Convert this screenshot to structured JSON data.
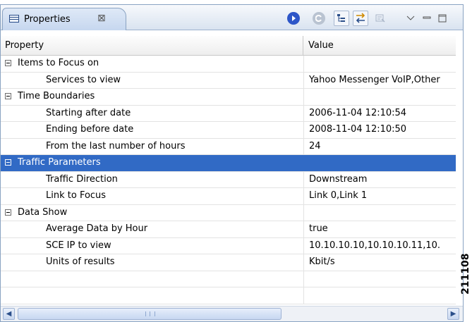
{
  "view": {
    "tab_title": "Properties",
    "tab_close": "⊠",
    "toolbar": {
      "icons": [
        "play-icon",
        "refresh-icon",
        "tree-icon",
        "filter-icon",
        "advanced-icon",
        "view-menu-icon",
        "minimize-icon",
        "maximize-icon"
      ],
      "colors": {
        "play": "#2d56c8",
        "refresh_disabled": "#b9c3d1"
      }
    }
  },
  "table": {
    "headers": {
      "property": "Property",
      "value": "Value"
    },
    "rows": [
      {
        "label": "Items to Focus on",
        "value": "",
        "category": true
      },
      {
        "label": "Services to view",
        "value": "Yahoo Messenger VoIP,Other",
        "category": false
      },
      {
        "label": "Time Boundaries",
        "value": "",
        "category": true
      },
      {
        "label": "Starting after date",
        "value": "2006-11-04 12:10:54",
        "category": false
      },
      {
        "label": "Ending before date",
        "value": "2008-11-04 12:10:50",
        "category": false
      },
      {
        "label": "From the last number of hours",
        "value": "24",
        "category": false
      },
      {
        "label": "Traffic Parameters",
        "value": "",
        "category": true,
        "selected": true
      },
      {
        "label": "Traffic Direction",
        "value": "Downstream",
        "category": false
      },
      {
        "label": "Link to Focus",
        "value": "Link 0,Link 1",
        "category": false
      },
      {
        "label": "Data Show",
        "value": "",
        "category": true
      },
      {
        "label": "Average Data by Hour",
        "value": "true",
        "category": false
      },
      {
        "label": "SCE IP to view",
        "value": "10.10.10.10,10.10.10.11,10.",
        "category": false
      },
      {
        "label": "Units of results",
        "value": "Kbit/s",
        "category": false
      },
      {
        "label": "",
        "value": "",
        "category": false
      },
      {
        "label": "",
        "value": "",
        "category": false
      }
    ],
    "selection_color": "#316ac5"
  },
  "scrollbar": {
    "left_arrow": "◀",
    "right_arrow": "▶"
  },
  "figure_id": "211108"
}
